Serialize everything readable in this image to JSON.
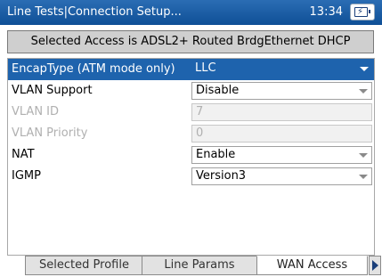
{
  "titlebar": {
    "title": "Line Tests|Connection Setup...",
    "time": "13:34"
  },
  "banner": {
    "text": "Selected Access  is ADSL2+ Routed BrdgEthernet DHCP"
  },
  "settings": [
    {
      "label": "EncapType (ATM mode only)",
      "value": "LLC",
      "kind": "dropdown",
      "state": "selected"
    },
    {
      "label": "VLAN Support",
      "value": "Disable",
      "kind": "dropdown",
      "state": "normal"
    },
    {
      "label": "VLAN ID",
      "value": "7",
      "kind": "text",
      "state": "disabled"
    },
    {
      "label": "VLAN Priority",
      "value": "0",
      "kind": "text",
      "state": "disabled"
    },
    {
      "label": "NAT",
      "value": "Enable",
      "kind": "dropdown",
      "state": "normal"
    },
    {
      "label": "IGMP",
      "value": "Version3",
      "kind": "dropdown",
      "state": "normal"
    }
  ],
  "tabs": [
    {
      "label": "Selected Profile",
      "active": false
    },
    {
      "label": "Line Params",
      "active": false
    },
    {
      "label": "WAN Access",
      "active": true
    }
  ],
  "icons": {
    "battery": "battery-charging-icon",
    "next_tab": "arrow-right-icon"
  },
  "colors": {
    "titlebar": "#1a5ea6",
    "selected_row": "#1e63ad"
  }
}
